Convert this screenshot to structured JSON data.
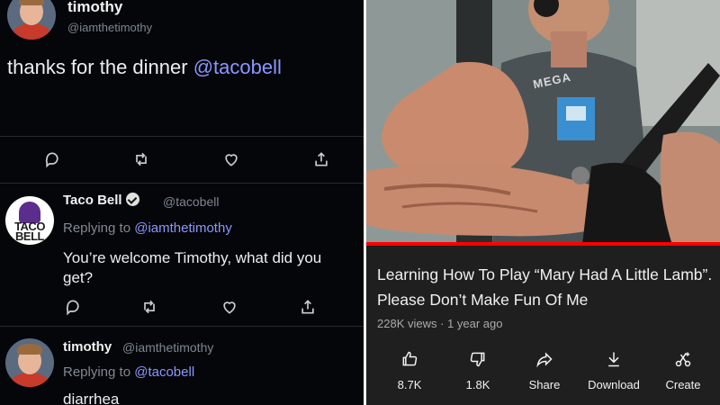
{
  "tweet1": {
    "name": "timothy",
    "handle": "@iamthetimothy",
    "text_prefix": "thanks for the dinner ",
    "mention": "@tacobell"
  },
  "tweet2": {
    "name": "Taco Bell",
    "handle": "@tacobell",
    "reply_prefix": "Replying to ",
    "reply_to": "@iamthetimothy",
    "text_line1": "You’re welcome Timothy, what did you",
    "text_line2": "get?",
    "logo_text_1": "TACO",
    "logo_text_2": "BELL"
  },
  "tweet3": {
    "name": "timothy",
    "handle": "@iamthetimothy",
    "reply_prefix": "Replying to ",
    "reply_to": "@tacobell",
    "text": "diarrhea"
  },
  "icons": {
    "reply": "reply-icon",
    "retweet": "retweet-icon",
    "like": "heart-icon",
    "share": "share-icon"
  },
  "video": {
    "shirt_text": "MEGA",
    "progress": 1.0,
    "title_line1": "Learning How To Play “Mary Had A Little Lamb”.",
    "title_line2": "Please Don’t Make Fun Of Me",
    "meta": "228K views · 1 year ago",
    "accent": "#ff0000"
  },
  "actions": {
    "like": "8.7K",
    "dislike": "1.8K",
    "share": "Share",
    "download": "Download",
    "create": "Create"
  },
  "colors": {
    "link": "#8a97ff",
    "twitter_bg": "#05060a",
    "youtube_bg": "#1f1f1f"
  }
}
